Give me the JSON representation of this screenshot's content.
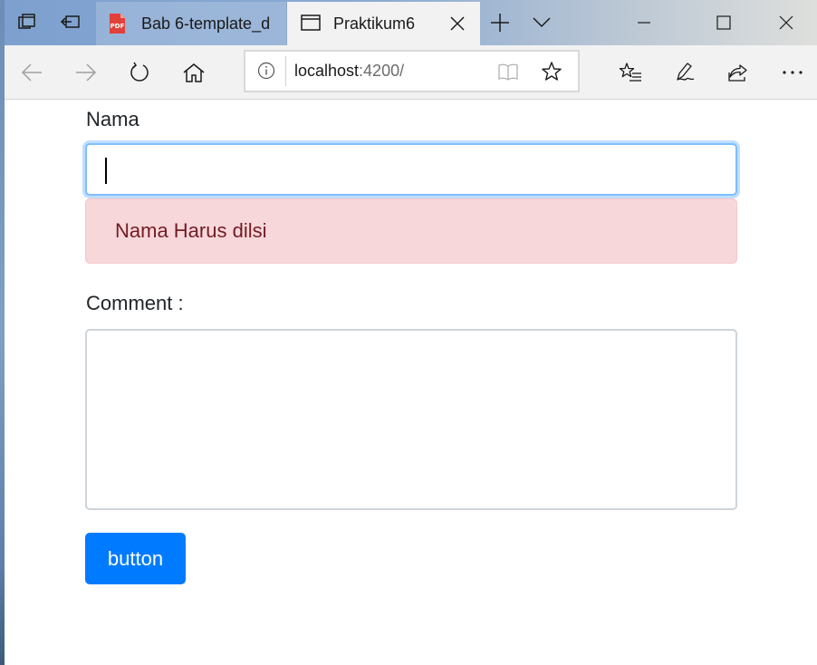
{
  "browser": {
    "tabs": [
      {
        "title": "Bab 6-template_d",
        "icon": "pdf-icon",
        "icon_text": "PDF",
        "active": false
      },
      {
        "title": "Praktikum6",
        "icon": "page-icon",
        "active": true
      }
    ],
    "address": {
      "host": "localhost",
      "path": ":4200/"
    }
  },
  "form": {
    "nama_label": "Nama",
    "nama_value": "",
    "error_message": "Nama Harus dilsi",
    "comment_label": "Comment :",
    "comment_value": "",
    "button_label": "button"
  },
  "colors": {
    "primary": "#007bff",
    "alert_bg": "#f8d7da",
    "alert_text": "#721c24",
    "focus_border": "#80bdff",
    "pdf_icon": "#e0413a"
  }
}
